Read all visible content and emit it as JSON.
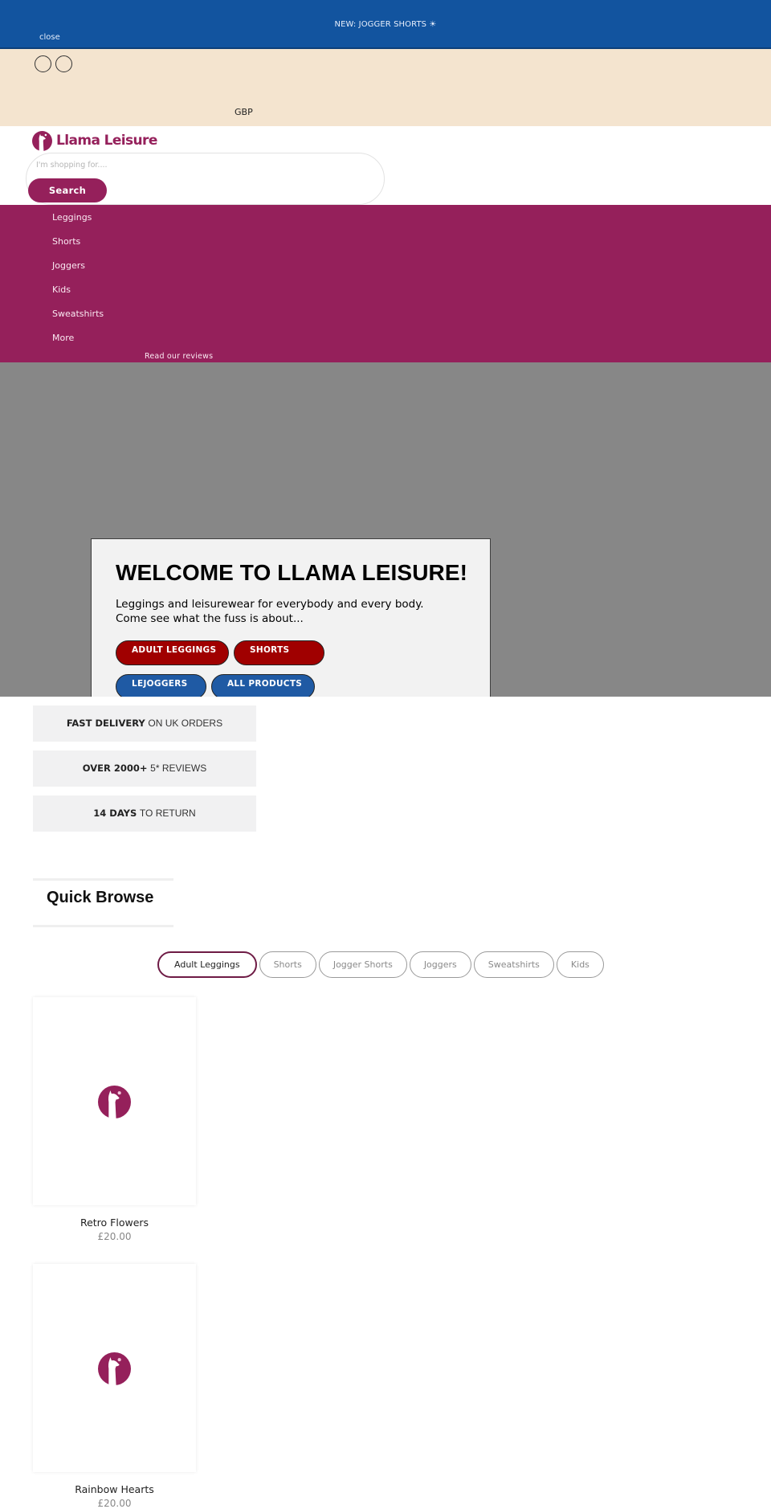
{
  "announcement": {
    "text": "NEW: JOGGER SHORTS ☀",
    "close_label": "close"
  },
  "utility_bar": {
    "currency": "GBP"
  },
  "header": {
    "brand_name": "Llama Leisure",
    "search": {
      "placeholder": "I'm shopping for....",
      "value": "",
      "button_label": "Search"
    }
  },
  "nav": {
    "items": [
      {
        "label": "Leggings"
      },
      {
        "label": "Shorts"
      },
      {
        "label": "Joggers"
      },
      {
        "label": "Kids"
      },
      {
        "label": "Sweatshirts"
      },
      {
        "label": "More"
      }
    ],
    "reviews_link": "Read our reviews"
  },
  "hero": {
    "title": "WELCOME TO LLAMA LEISURE!",
    "subtitle_line1": "Leggings and leisurewear for everybody and every body.",
    "subtitle_line2": "Come see what the fuss is about...",
    "buttons": [
      {
        "label": "ADULT LEGGINGS",
        "color": "#a00000"
      },
      {
        "label": "SHORTS",
        "color": "#a00000"
      },
      {
        "label": "LEJOGGERS",
        "color": "#1f5aa4"
      },
      {
        "label": "ALL PRODUCTS",
        "color": "#1f5aa4"
      }
    ]
  },
  "usps": [
    {
      "bold": "FAST DELIVERY",
      "rest": "ON UK ORDERS"
    },
    {
      "bold": "OVER 2000+",
      "rest": "5* REVIEWS"
    },
    {
      "bold": "14 DAYS",
      "rest": "TO RETURN"
    }
  ],
  "quick_browse": {
    "title": "Quick Browse",
    "tabs": [
      {
        "label": "Adult Leggings",
        "active": true
      },
      {
        "label": "Shorts",
        "active": false
      },
      {
        "label": "Jogger Shorts",
        "active": false
      },
      {
        "label": "Joggers",
        "active": false
      },
      {
        "label": "Sweatshirts",
        "active": false
      },
      {
        "label": "Kids",
        "active": false
      }
    ],
    "products": [
      {
        "name": "Retro Flowers",
        "price": "£20.00"
      },
      {
        "name": "Rainbow Hearts",
        "price": "£20.00"
      }
    ]
  },
  "colors": {
    "brand": "#95205b",
    "announcement_bg": "#12549f",
    "utility_bg": "#f4e4cf",
    "hero_bg": "#878787"
  }
}
